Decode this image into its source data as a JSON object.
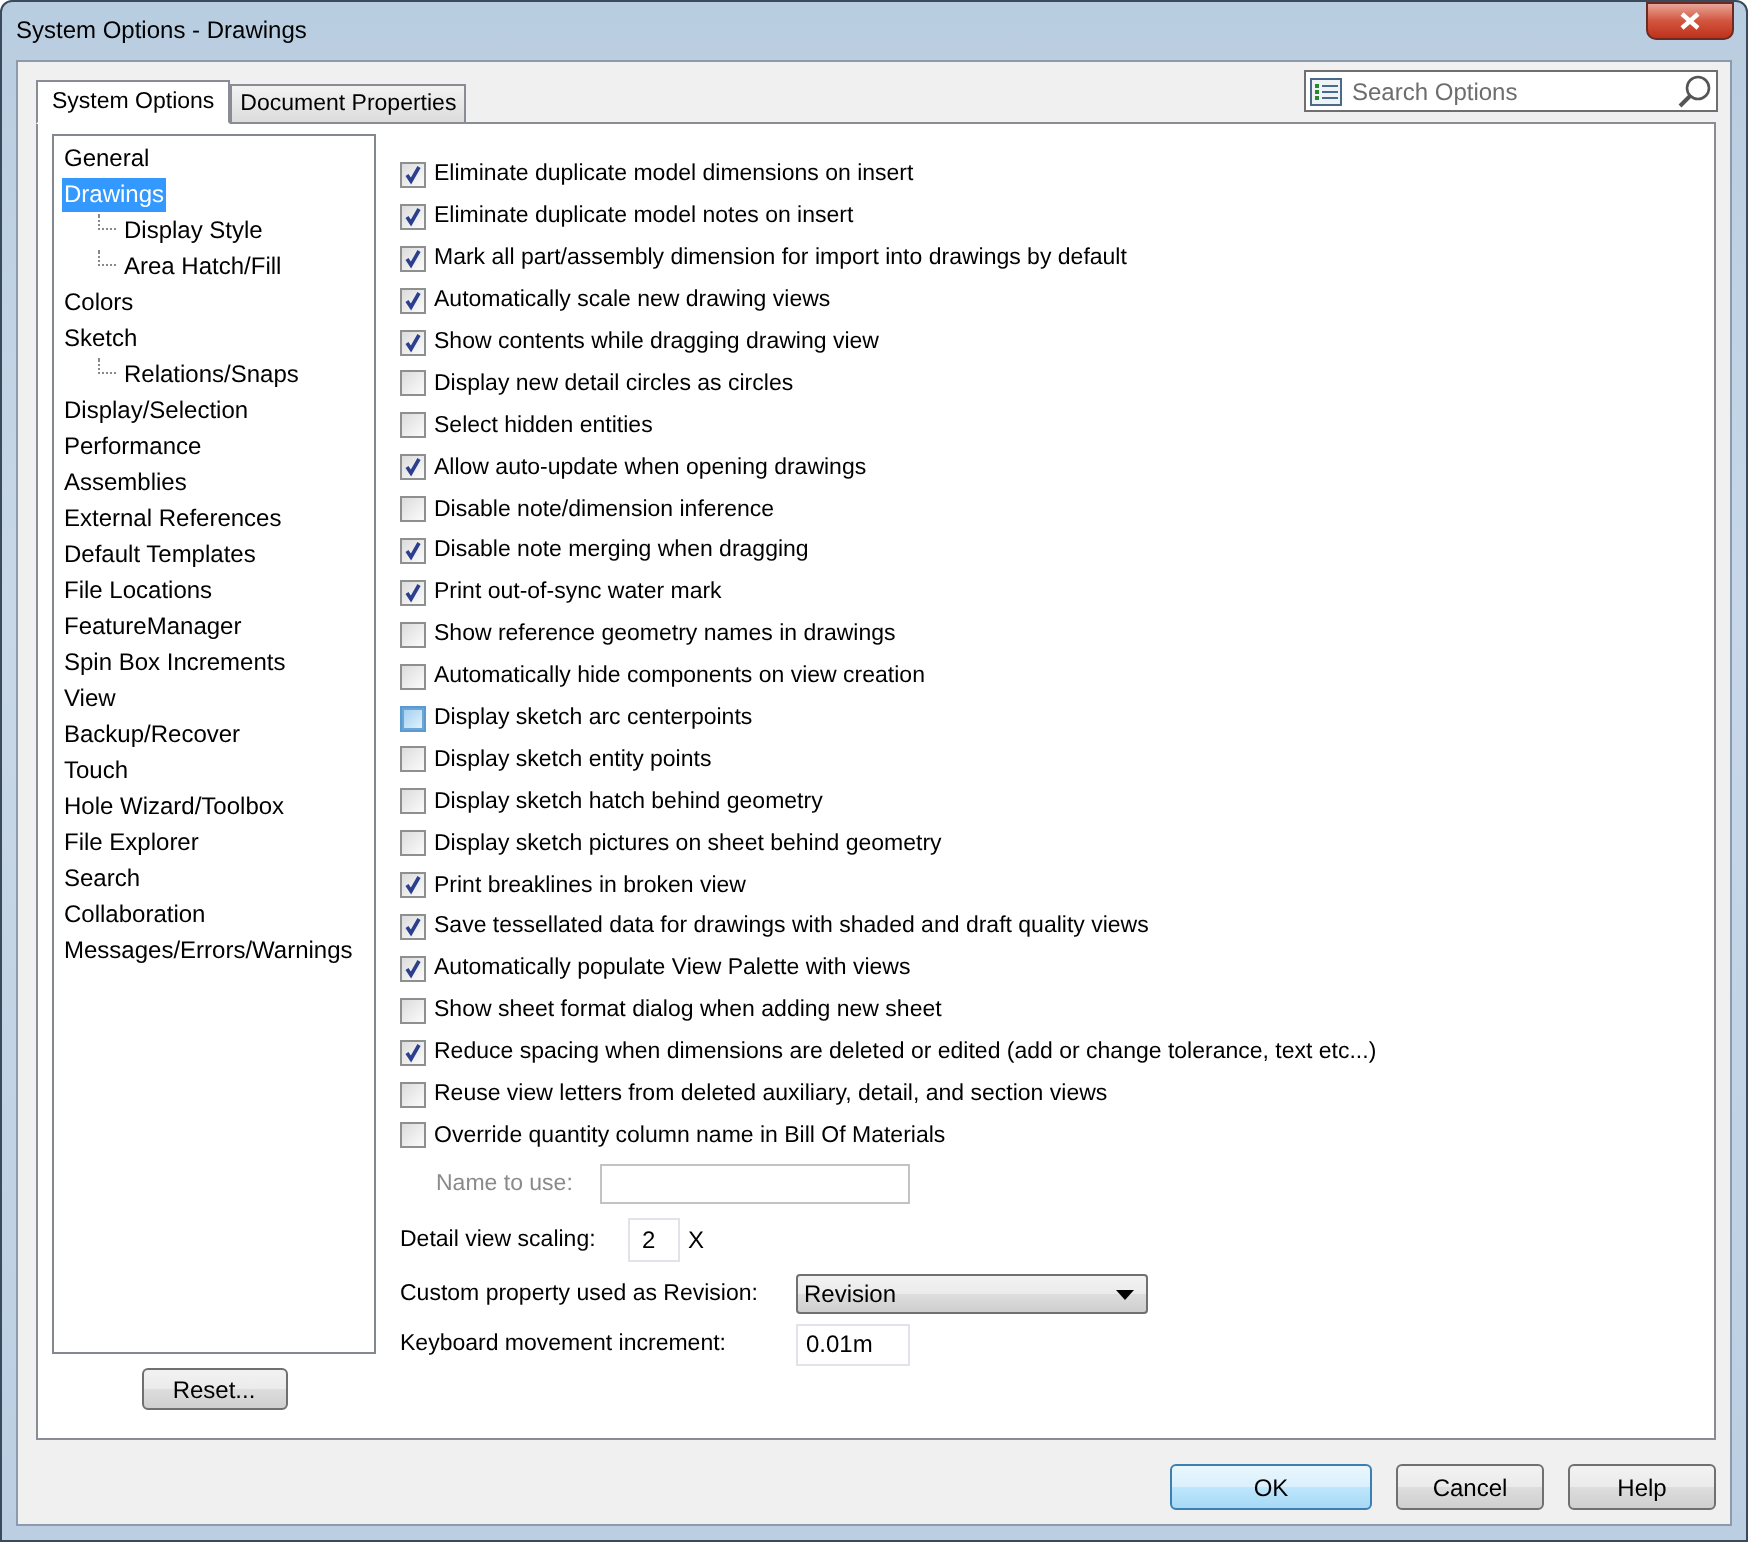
{
  "window": {
    "title": "System Options - Drawings"
  },
  "tabs": [
    {
      "label": "System Options",
      "selected": true
    },
    {
      "label": "Document Properties",
      "selected": false
    }
  ],
  "search": {
    "placeholder": "Search Options"
  },
  "tree": {
    "items": [
      {
        "label": "General",
        "selected": false
      },
      {
        "label": "Drawings",
        "selected": true,
        "children": [
          {
            "label": "Display Style",
            "selected": false
          },
          {
            "label": "Area Hatch/Fill",
            "selected": false
          }
        ]
      },
      {
        "label": "Colors",
        "selected": false
      },
      {
        "label": "Sketch",
        "selected": false,
        "children": [
          {
            "label": "Relations/Snaps",
            "selected": false
          }
        ]
      },
      {
        "label": "Display/Selection",
        "selected": false
      },
      {
        "label": "Performance",
        "selected": false
      },
      {
        "label": "Assemblies",
        "selected": false
      },
      {
        "label": "External References",
        "selected": false
      },
      {
        "label": "Default Templates",
        "selected": false
      },
      {
        "label": "File Locations",
        "selected": false
      },
      {
        "label": "FeatureManager",
        "selected": false
      },
      {
        "label": "Spin Box Increments",
        "selected": false
      },
      {
        "label": "View",
        "selected": false
      },
      {
        "label": "Backup/Recover",
        "selected": false
      },
      {
        "label": "Touch",
        "selected": false
      },
      {
        "label": "Hole Wizard/Toolbox",
        "selected": false
      },
      {
        "label": "File Explorer",
        "selected": false
      },
      {
        "label": "Search",
        "selected": false
      },
      {
        "label": "Collaboration",
        "selected": false
      },
      {
        "label": "Messages/Errors/Warnings",
        "selected": false
      }
    ]
  },
  "reset_button": "Reset...",
  "options": [
    {
      "label": "Eliminate duplicate model dimensions on insert",
      "checked": true,
      "hovered": false
    },
    {
      "label": "Eliminate duplicate model notes on insert",
      "checked": true,
      "hovered": false
    },
    {
      "label": "Mark all part/assembly dimension for import into drawings by default",
      "checked": true,
      "hovered": false
    },
    {
      "label": "Automatically scale new drawing views",
      "checked": true,
      "hovered": false
    },
    {
      "label": "Show contents while dragging drawing view",
      "checked": true,
      "hovered": false
    },
    {
      "label": "Display new detail circles as circles",
      "checked": false,
      "hovered": false
    },
    {
      "label": "Select hidden entities",
      "checked": false,
      "hovered": false
    },
    {
      "label": "Allow auto-update when opening drawings",
      "checked": true,
      "hovered": false
    },
    {
      "label": "Disable note/dimension inference",
      "checked": false,
      "hovered": false
    },
    {
      "label": "Disable note merging when dragging",
      "checked": true,
      "hovered": false
    },
    {
      "label": "Print out-of-sync water mark",
      "checked": true,
      "hovered": false
    },
    {
      "label": "Show reference geometry names in drawings",
      "checked": false,
      "hovered": false
    },
    {
      "label": "Automatically hide components on view creation",
      "checked": false,
      "hovered": false
    },
    {
      "label": "Display sketch arc centerpoints",
      "checked": false,
      "hovered": true
    },
    {
      "label": "Display sketch entity points",
      "checked": false,
      "hovered": false
    },
    {
      "label": "Display sketch hatch behind geometry",
      "checked": false,
      "hovered": false
    },
    {
      "label": "Display sketch pictures on sheet behind geometry",
      "checked": false,
      "hovered": false
    },
    {
      "label": "Print breaklines in broken view",
      "checked": true,
      "hovered": false
    },
    {
      "label": "Save tessellated data for drawings with shaded and draft quality views",
      "checked": true,
      "hovered": false
    },
    {
      "label": "Automatically populate View Palette with views",
      "checked": true,
      "hovered": false
    },
    {
      "label": "Show sheet format dialog when adding new sheet",
      "checked": false,
      "hovered": false
    },
    {
      "label": "Reduce spacing when dimensions are deleted or edited (add or change tolerance, text etc...)",
      "checked": true,
      "hovered": false
    },
    {
      "label": "Reuse view letters from deleted auxiliary, detail, and section views",
      "checked": false,
      "hovered": false
    },
    {
      "label": "Override quantity column name in Bill Of Materials",
      "checked": false,
      "hovered": false
    }
  ],
  "name_to_use": {
    "label": "Name to use:",
    "disabled": true
  },
  "detail_view_scaling": {
    "label": "Detail view scaling:",
    "value": "2",
    "unit": "X"
  },
  "revision_property": {
    "label": "Custom property used as Revision:",
    "value": "Revision"
  },
  "keyboard_increment": {
    "label": "Keyboard movement increment:",
    "value": "0.01m"
  },
  "buttons": [
    {
      "label": "OK",
      "default": true
    },
    {
      "label": "Cancel",
      "default": false
    },
    {
      "label": "Help",
      "default": false
    }
  ]
}
